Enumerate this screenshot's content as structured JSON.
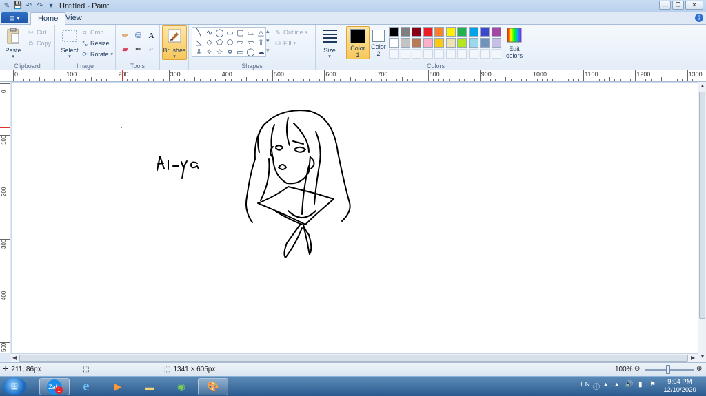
{
  "window": {
    "title": "Untitled - Paint"
  },
  "tabs": [
    {
      "label": "Home",
      "active": true
    },
    {
      "label": "View",
      "active": false
    }
  ],
  "ribbon": {
    "clipboard": {
      "label": "Clipboard",
      "paste": "Paste",
      "cut": "Cut",
      "copy": "Copy"
    },
    "image": {
      "label": "Image",
      "select": "Select",
      "crop": "Crop",
      "resize": "Resize",
      "rotate": "Rotate"
    },
    "tools": {
      "label": "Tools"
    },
    "brushes": {
      "label": "Brushes"
    },
    "shapes": {
      "label": "Shapes",
      "outline": "Outline",
      "fill": "Fill"
    },
    "size": {
      "label": "Size"
    },
    "colors": {
      "label": "Colors",
      "color1_label": "Color\n1",
      "color2_label": "Color\n2",
      "color1": "#000000",
      "color2": "#ffffff",
      "edit_colors": "Edit colors",
      "palette": [
        "#000000",
        "#7f7f7f",
        "#880015",
        "#ed1c24",
        "#ff7f27",
        "#fff200",
        "#22b14c",
        "#00a2e8",
        "#3f48cc",
        "#a349a4",
        "#ffffff",
        "#c3c3c3",
        "#b97a57",
        "#ffaec9",
        "#ffc90e",
        "#efe4b0",
        "#b5e61d",
        "#99d9ea",
        "#7092be",
        "#c8bfe7"
      ]
    }
  },
  "ruler": {
    "top_labels": [
      "0",
      "100",
      "200",
      "300",
      "400",
      "500",
      "600",
      "700",
      "800",
      "900",
      "1000",
      "1100",
      "1200",
      "1300"
    ],
    "left_labels": [
      "0",
      "100",
      "200",
      "300",
      "400",
      "500"
    ]
  },
  "canvas": {
    "text_drawing": "Ai-ya"
  },
  "status": {
    "cursor_pos": "211, 86px",
    "canvas_size": "1341 × 605px",
    "zoom": "100%"
  },
  "taskbar": {
    "apps": [
      "Zalo",
      "Internet Explorer",
      "Media Player",
      "File Explorer",
      "Browser",
      "Paint"
    ],
    "zalo_badge": "1",
    "lang": "EN",
    "time": "9:04 PM",
    "date": "12/10/2020"
  }
}
